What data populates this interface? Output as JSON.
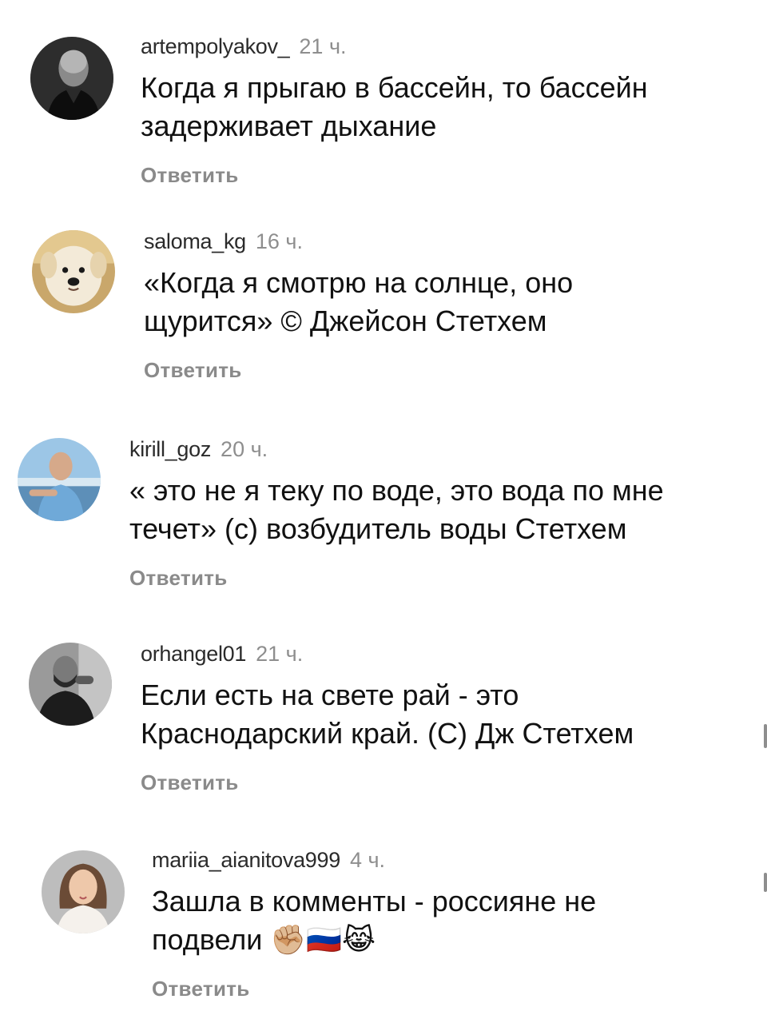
{
  "reply_label": "Ответить",
  "comments": [
    {
      "username": "artempolyakov_",
      "time": "21 ч.",
      "text": "Когда я прыгаю в бассейн, то бассейн\nзадерживает дыхание",
      "avatar": "man-bald-dark-avatar"
    },
    {
      "username": "saloma_kg",
      "time": "16 ч.",
      "text": "«Когда я смотрю на солнце, оно\nщурится» © Джейсон Стетхем",
      "avatar": "dog-avatar"
    },
    {
      "username": "kirill_goz",
      "time": "20 ч.",
      "text": "« это не я теку по воде, это вода по мне\nтечет» (с) возбудитель воды Стетхем",
      "avatar": "man-bald-blue-shirt-avatar"
    },
    {
      "username": "orhangel01",
      "time": "21 ч.",
      "text": "Если есть на свете рай - это\nКраснодарский край. (С) Дж Стетхем",
      "avatar": "man-bearded-grayscale-avatar"
    },
    {
      "username": "mariia_aianitova999",
      "time": "4 ч.",
      "text": "Зашла в комменты - россияне не\nподвели ✊🏼🇷🇺😹",
      "avatar": "woman-avatar"
    }
  ],
  "colors": {
    "username": "#2b2b2b",
    "time": "#8e8e8e",
    "text": "#111111",
    "reply": "#8a8a8a"
  }
}
